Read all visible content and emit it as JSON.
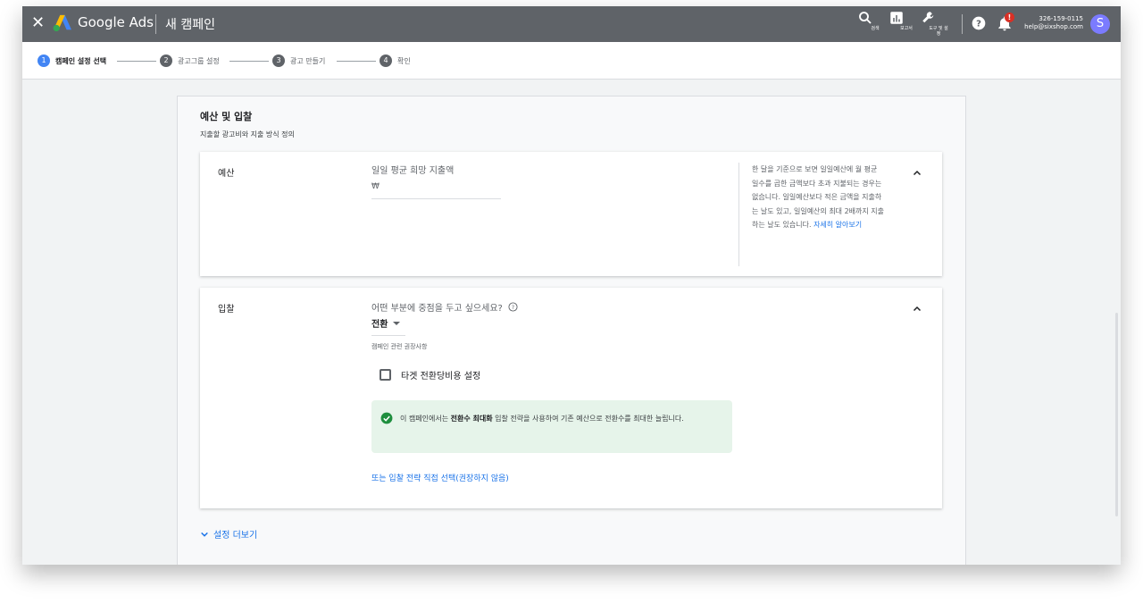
{
  "app": {
    "brand": "Google Ads",
    "page_title": "새 캠페인"
  },
  "toolbar": {
    "search_label": "검색",
    "reports_label": "보고서",
    "tools_label_line1": "도구 및 설",
    "tools_label_line2": "정",
    "notification_badge": "!",
    "account_id": "326-159-0115",
    "account_email": "help@sixshop.com",
    "avatar_letter": "S"
  },
  "steps": [
    {
      "num": "1",
      "label": "캠페인 설정 선택"
    },
    {
      "num": "2",
      "label": "광고그룹 설정"
    },
    {
      "num": "3",
      "label": "광고 만들기"
    },
    {
      "num": "4",
      "label": "확인"
    }
  ],
  "section": {
    "title": "예산 및 입찰",
    "subtitle": "지출할 광고비와 지출 방식 정의"
  },
  "budget": {
    "label": "예산",
    "field_label": "일일 평균 희망 지출액",
    "currency": "₩",
    "help_text": "한 달을 기준으로 보면 일일예산에 월 평균 일수를 곱한 금액보다 초과 지불되는 경우는 없습니다. 일일예산보다 적은 금액을 지출하는 날도 있고, 일일예산의 최대 2배까지 지출하는 날도 있습니다.",
    "help_link": "자세히 알아보기"
  },
  "bidding": {
    "label": "입찰",
    "question": "어떤 부분에 중점을 두고 싶으세요?",
    "selected": "전환",
    "recommendation": "캠페인 관련 권장사항",
    "checkbox_label": "타겟 전환당비용 설정",
    "info_prefix": "이 캠페인에서는 ",
    "info_bold": "전환수 최대화",
    "info_suffix": " 입찰 전략을 사용하여 기존 예산으로 전환수를 최대한 늘립니다.",
    "alt_link": "또는 입찰 전략 직접 선택(권장하지 않음)"
  },
  "more_settings": "설정 더보기",
  "colors": {
    "topbar": "#5f6368",
    "accent": "#1a73e8",
    "step_active": "#4285f4",
    "success_bg": "#e6f4ea",
    "success_icon": "#1e8e3e",
    "badge": "#d93025"
  }
}
